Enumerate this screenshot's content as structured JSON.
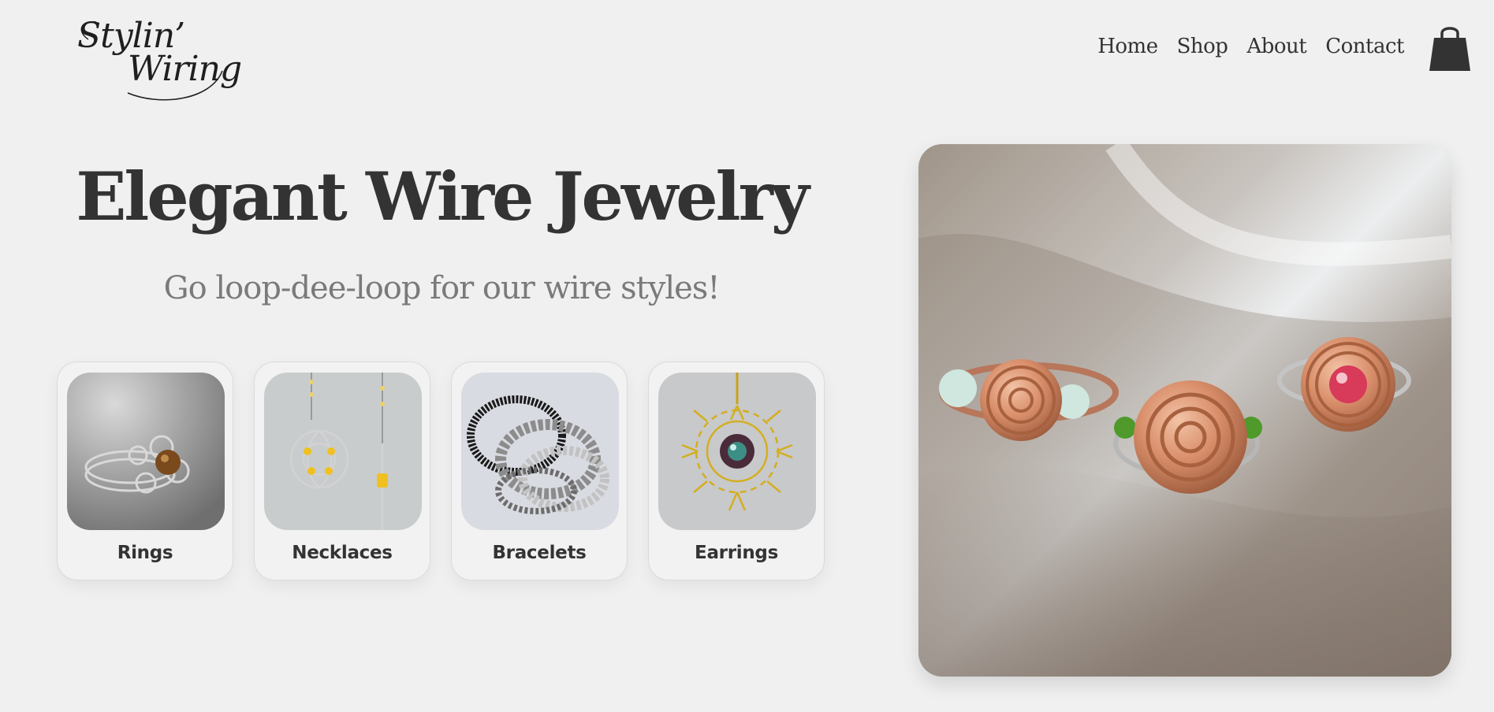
{
  "brand": {
    "logo_line1": "Stylin’",
    "logo_line2": "Wiring"
  },
  "nav": {
    "items": [
      "Home",
      "Shop",
      "About",
      "Contact"
    ]
  },
  "cart": {
    "icon": "shopping-bag-icon"
  },
  "hero": {
    "title": "Elegant Wire Jewelry",
    "subtitle": "Go loop-dee-loop for our wire styles!"
  },
  "categories": [
    {
      "label": "Rings"
    },
    {
      "label": "Necklaces"
    },
    {
      "label": "Bracelets"
    },
    {
      "label": "Earrings"
    }
  ],
  "colors": {
    "background": "#f0f0f0",
    "text": "#333333",
    "subtitle": "#7a7a7a",
    "card_border": "#dadada"
  }
}
